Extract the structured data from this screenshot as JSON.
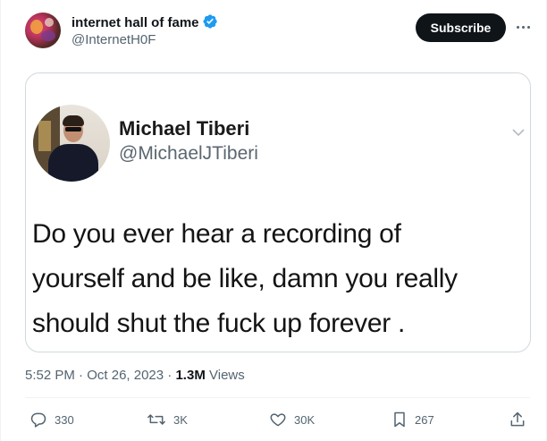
{
  "author": {
    "name": "internet hall of fame",
    "handle": "@InternetH0F",
    "verified": true
  },
  "subscribe_label": "Subscribe",
  "embedded_tweet": {
    "name": "Michael Tiberi",
    "handle": "@MichaelJTiberi",
    "text_lines": [
      "Do you ever hear a recording of",
      "yourself and be like, damn you really",
      "should shut the fuck up forever ."
    ]
  },
  "meta": {
    "time": "5:52 PM",
    "separator": " · ",
    "date": "Oct 26, 2023",
    "views_count": "1.3M",
    "views_label": "Views"
  },
  "actions": {
    "replies": "330",
    "reposts": "3K",
    "likes": "30K",
    "bookmarks": "267"
  },
  "colors": {
    "verified": "#1d9bf0",
    "secondary_text": "#536471",
    "primary_text": "#0f1419",
    "subscribe_bg": "#0f1419"
  },
  "icons": [
    "verified-badge-icon",
    "more-icon",
    "chevron-down-icon",
    "reply-icon",
    "repost-icon",
    "like-icon",
    "bookmark-icon",
    "share-icon"
  ]
}
